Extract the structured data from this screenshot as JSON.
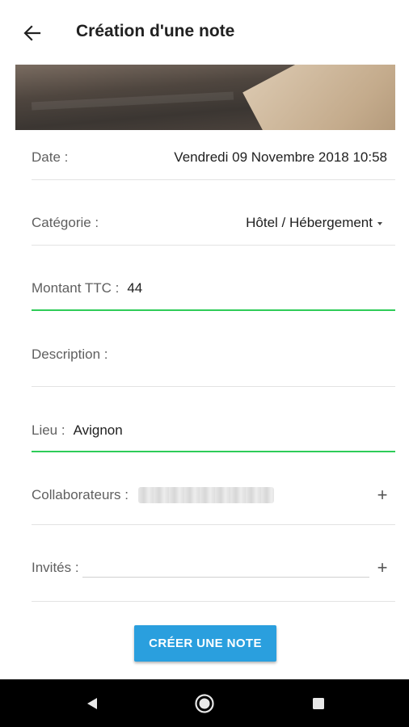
{
  "header": {
    "title": "Création d'une note",
    "back_icon": "arrow-left-icon"
  },
  "banner": {
    "image_icon": "wooden-floor-photo"
  },
  "form": {
    "date": {
      "label": "Date :",
      "value": "Vendredi 09 Novembre 2018 10:58"
    },
    "category": {
      "label": "Catégorie :",
      "value": "Hôtel / Hébergement",
      "icon": "dropdown-caret-icon"
    },
    "amount": {
      "label": "Montant TTC :",
      "value": "44"
    },
    "description": {
      "label": "Description :",
      "value": ""
    },
    "location": {
      "label": "Lieu :",
      "value": "Avignon"
    },
    "collaborators": {
      "label": "Collaborateurs :",
      "value_note": "blurred-email",
      "add_icon": "plus-icon"
    },
    "guests": {
      "label": "Invités :",
      "value": "",
      "add_icon": "plus-icon"
    }
  },
  "actions": {
    "create_label": "CRÉER UNE NOTE"
  },
  "system_nav": {
    "back_icon": "triangle-back-icon",
    "home_icon": "circle-home-icon",
    "recent_icon": "square-recents-icon"
  },
  "colors": {
    "accent_button": "#2a9fde",
    "active_underline": "#2ecc58",
    "divider": "#e3e3e3",
    "nav_bar": "#000000"
  }
}
